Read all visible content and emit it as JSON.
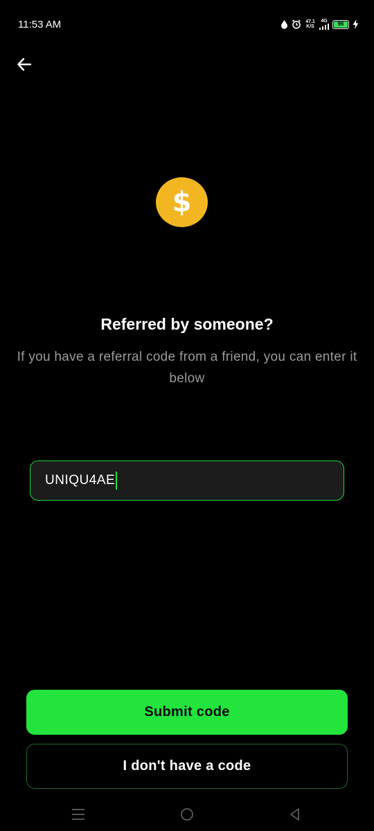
{
  "status_bar": {
    "time": "11:53 AM",
    "net_speed_value": "47.1",
    "net_speed_unit": "K/S",
    "network_type": "4G",
    "battery_level": "96",
    "icons": [
      "water-drop-icon",
      "alarm-icon",
      "signal-icon",
      "battery-icon",
      "charging-icon"
    ]
  },
  "header": {
    "back_icon": "arrow-left-icon"
  },
  "hero": {
    "icon": "dollar-coin-icon",
    "coin_color": "#f2b623",
    "coin_symbol": "$",
    "title": "Referred by someone?",
    "subtitle": "If you have a referral code from a friend, you can enter it below"
  },
  "referral_input": {
    "value": "UNIQU4AE",
    "accent_color": "#22d63e"
  },
  "actions": {
    "submit_label": "Submit code",
    "no_code_label": "I don't have a code",
    "primary_color": "#23e33d"
  },
  "nav_bar": {
    "icons": [
      "menu-icon",
      "home-icon",
      "back-triangle-icon"
    ]
  }
}
